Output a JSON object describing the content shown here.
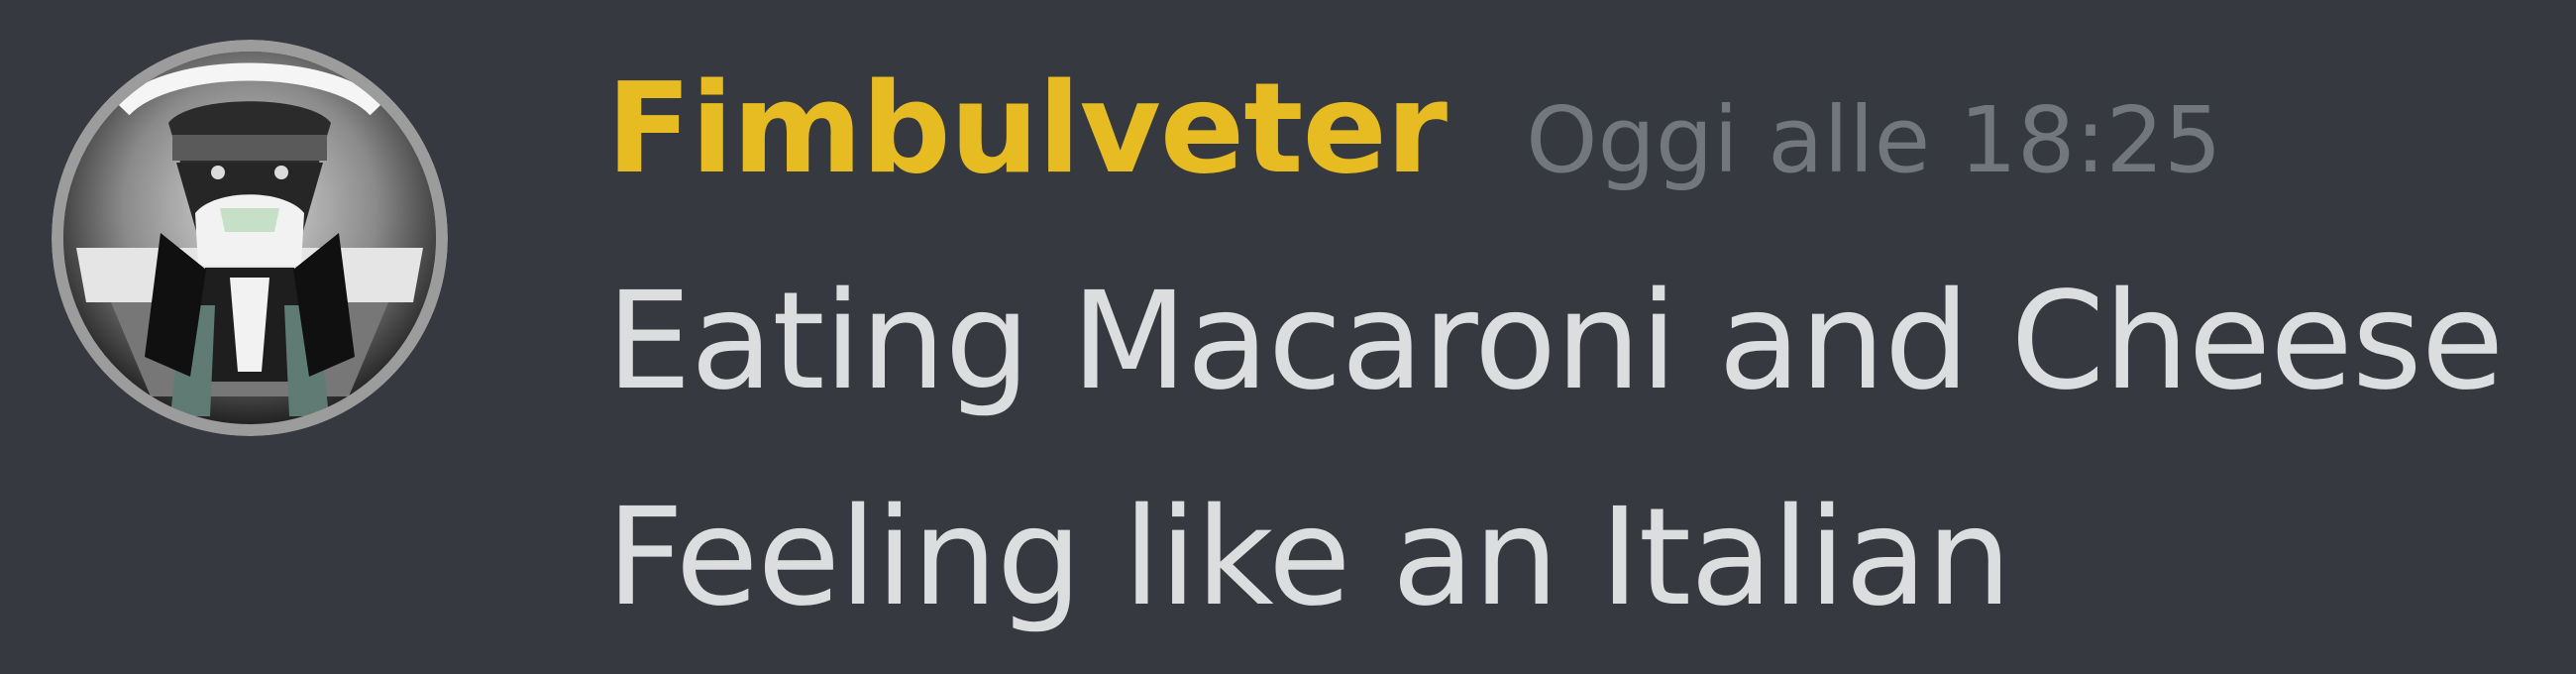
{
  "message": {
    "author": "Fimbulveter",
    "timestamp": "Oggi alle 18:25",
    "lines": [
      "Eating Macaroni and Cheese",
      "Feeling like an Italian"
    ]
  },
  "colors": {
    "background": "#36393f",
    "author": "#e6bc22",
    "timestamp": "#72767d",
    "text": "#dcddde"
  },
  "icons": {
    "avatar": "user-avatar-icon"
  }
}
